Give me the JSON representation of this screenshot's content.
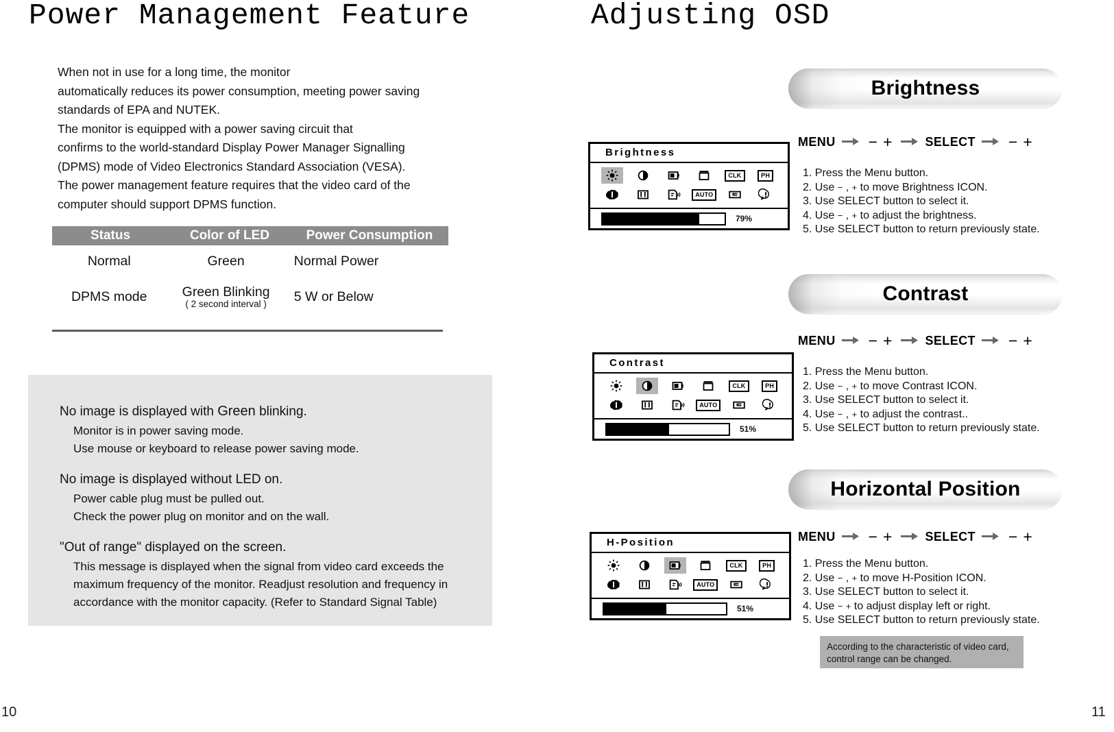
{
  "left_page": {
    "title": "Power Management Feature",
    "page_number": "10",
    "intro_lines": [
      "When not in use for a long time, the monitor",
      "automatically reduces its power consumption, meeting power saving",
      "standards of EPA and NUTEK.",
      "The monitor is equipped with a power saving circuit that",
      "confirms to the world-standard Display Power Manager Signalling",
      "(DPMS) mode of Video Electronics Standard Association (VESA).",
      "The power management feature requires that the video card of the",
      "computer should support DPMS function."
    ],
    "table": {
      "headers": [
        "Status",
        "Color of LED",
        "Power Consumption"
      ],
      "rows": [
        {
          "status": "Normal",
          "led": "Green",
          "led_note": "",
          "power": "Normal Power"
        },
        {
          "status": "DPMS mode",
          "led": "Green Blinking",
          "led_note": "( 2 second interval )",
          "power": "5 W or Below"
        }
      ]
    },
    "trouble": {
      "groups": [
        {
          "heading_pre": "No image is displayed with ",
          "heading_em": "Green",
          "heading_post": " blinking.",
          "items": [
            "Monitor is in power saving mode.",
            "Use mouse or keyboard to release power saving mode."
          ]
        },
        {
          "heading_pre": "No image is displayed without LED on.",
          "heading_em": "",
          "heading_post": "",
          "items": [
            "Power cable plug must be pulled out.",
            "Check the power plug on monitor and on the wall."
          ]
        },
        {
          "heading_pre": "\"Out of range\" displayed on the screen.",
          "heading_em": "",
          "heading_post": "",
          "items": [
            "This message is displayed when the signal from video card exceeds the",
            "maximum frequency of the monitor. Readjust resolution and frequency in",
            "accordance with the monitor capacity. (Refer to Standard Signal Table)"
          ]
        }
      ]
    }
  },
  "right_page": {
    "title": "Adjusting OSD",
    "page_number": "11",
    "menu_sequence": {
      "menu_label": "MENU",
      "select_label": "SELECT",
      "minus": "−",
      "plus": "+",
      "arrow": "arrow-right-icon"
    },
    "osd_icon_names": [
      "brightness-icon",
      "contrast-icon",
      "h-position-icon",
      "v-position-icon",
      "clk-icon",
      "ph-icon",
      "color-temp-icon",
      "v-size-icon",
      "language-icon",
      "auto-icon",
      "recall-icon",
      "osd-info-icon"
    ],
    "osd_icon_labels": [
      "",
      "",
      "",
      "",
      "CLK",
      "PH",
      "",
      "",
      "",
      "AUTO",
      "",
      ""
    ],
    "panels": [
      {
        "banner": "Brightness",
        "osd_title": "Brightness",
        "selected_index": 0,
        "percent_label": "79%",
        "percent_value": 79,
        "steps": [
          "1. Press the Menu button.",
          "2. Use − , + to move Brightness ICON.",
          "3. Use SELECT button to select it.",
          "4. Use − , + to adjust the brightness.",
          "5. Use SELECT button to return previously state."
        ]
      },
      {
        "banner": "Contrast",
        "osd_title": "Contrast",
        "selected_index": 1,
        "percent_label": "51%",
        "percent_value": 51,
        "steps": [
          "1. Press the Menu button.",
          "2. Use − , + to move Contrast ICON.",
          "3. Use SELECT button to select it.",
          "4. Use − , + to adjust the contrast..",
          "5. Use SELECT button to return previously state."
        ]
      },
      {
        "banner": "Horizontal Position",
        "osd_title": "H-Position",
        "selected_index": 2,
        "percent_label": "51%",
        "percent_value": 51,
        "steps": [
          "1. Press the Menu button.",
          "2. Use − , + to move  H-Position ICON.",
          "3. Use SELECT button to select it.",
          "4. Use −  + to adjust display left or right.",
          "5. Use SELECT button to return previously state."
        ]
      }
    ],
    "note": [
      "According to the characteristic of video card,",
      "control range can be changed."
    ]
  },
  "colors": {
    "table_header_bg": "#8c8c8c",
    "trouble_bg": "#e5e5e5",
    "note_bg": "#b0b0b0",
    "selected_icon_bg": "#b4b4b4",
    "ink": "#000000"
  }
}
